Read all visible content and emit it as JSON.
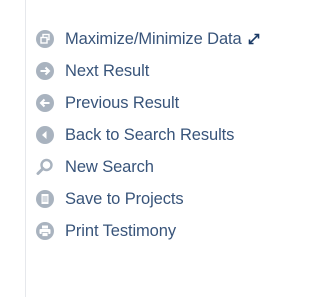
{
  "menu": {
    "items": [
      {
        "label": "Maximize/Minimize Data",
        "icon": "window-restore-icon"
      },
      {
        "label": "Next Result",
        "icon": "arrow-right-icon"
      },
      {
        "label": "Previous Result",
        "icon": "arrow-left-icon"
      },
      {
        "label": "Back to Search Results",
        "icon": "triangle-left-icon"
      },
      {
        "label": "New Search",
        "icon": "magnifier-icon"
      },
      {
        "label": "Save to Projects",
        "icon": "document-icon"
      },
      {
        "label": "Print Testimony",
        "icon": "printer-icon"
      }
    ],
    "extra_icon": "expand-arrows-icon"
  },
  "colors": {
    "text": "#38547a",
    "icon_bg": "#a9b3bf",
    "icon_fg": "#ffffff",
    "expand_icon": "#1a3a66"
  }
}
